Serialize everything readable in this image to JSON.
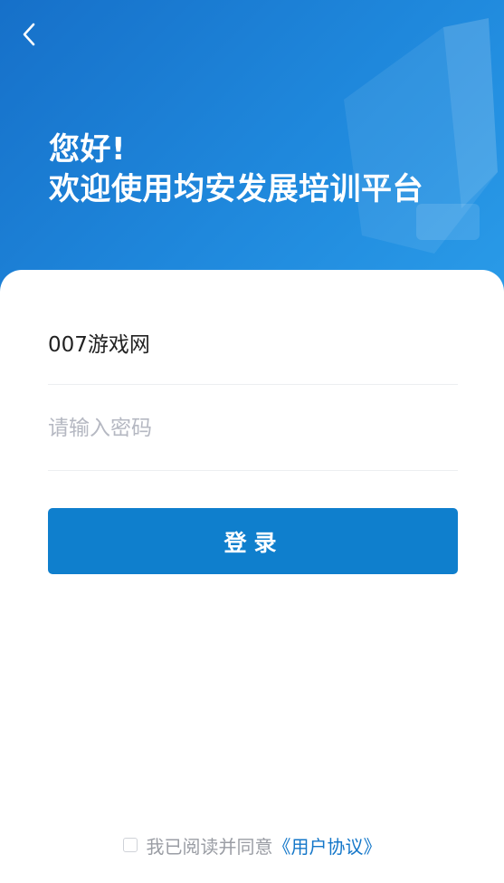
{
  "header": {
    "greeting_line1": "您好!",
    "greeting_line2": "欢迎使用均安发展培训平台"
  },
  "form": {
    "username_value": "007游戏网",
    "password_placeholder": "请输入密码",
    "login_label": "登录"
  },
  "agreement": {
    "text": "我已阅读并同意",
    "link": "《用户协议》"
  },
  "icons": {
    "back": "chevron-left-icon",
    "checkbox": "checkbox-unchecked-icon"
  },
  "colors": {
    "header_start": "#1670c9",
    "header_end": "#2a9be8",
    "primary": "#0f7fcd",
    "link": "#1477c9",
    "placeholder": "#b5b8c2"
  }
}
